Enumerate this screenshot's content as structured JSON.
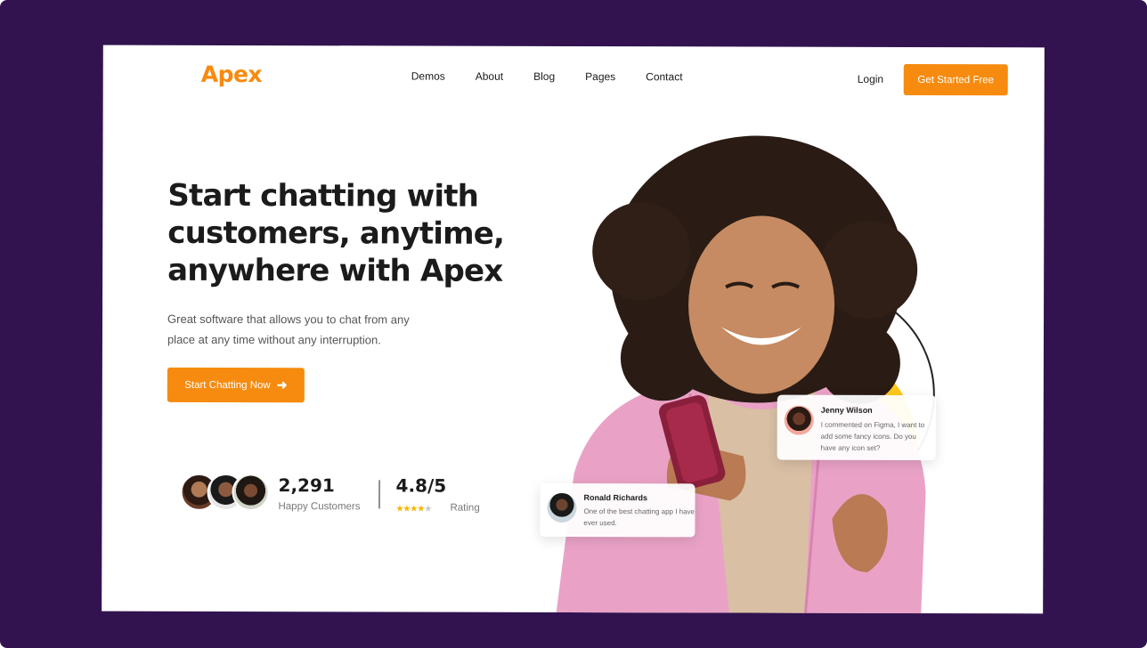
{
  "brand": {
    "logo": "Apex",
    "accent": "#F68B0F",
    "background": "#321350"
  },
  "nav": {
    "items": [
      "Demos",
      "About",
      "Blog",
      "Pages",
      "Contact"
    ],
    "login": "Login",
    "cta": "Get Started Free"
  },
  "hero": {
    "title": "Start chatting with customers, anytime, anywhere with Apex",
    "subtitle": "Great software that allows you to chat from any place at any time without any interruption.",
    "cta": "Start Chatting Now",
    "cta_icon": "arrow-right-icon"
  },
  "stats": {
    "customers_value": "2,291",
    "customers_label": "Happy Customers",
    "rating_value": "4.8/5",
    "rating_label": "Rating",
    "rating_stars_filled": 4,
    "rating_stars_total": 5
  },
  "messages": {
    "jenny": {
      "name": "Jenny Wilson",
      "text": "I commented on Figma, I want to add some fancy icons. Do you have any icon set?"
    },
    "ronald": {
      "name": "Ronald Richards",
      "text": "One of the best chatting app I have ever used."
    }
  }
}
